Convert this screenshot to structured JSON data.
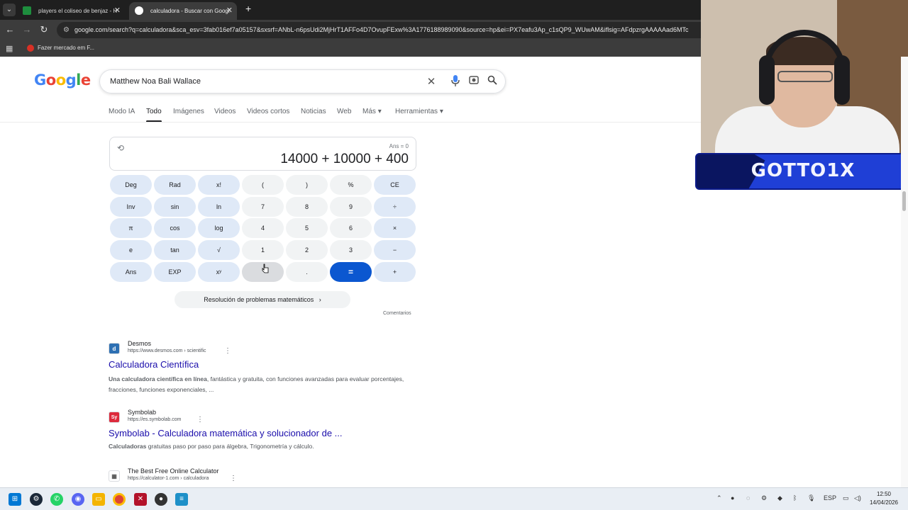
{
  "browser": {
    "tabs": [
      {
        "label": "players el coliseo de benjaz - H",
        "favicon_color": "#1e8e3e"
      },
      {
        "label": "calculadora - Buscar con Googl",
        "favicon_color": "#ffffff"
      }
    ],
    "url": "google.com/search?q=calculadora&sca_esv=3fab016ef7a05157&sxsrf=ANbL-n6psUdi2MjHrT1AFFo4D7OvupFExw%3A1776188989090&source=hp&ei=PX7eafu3Ap_c1sQP9_WUwAM&iflsig=AFdpzrgAAAAAad6MTc",
    "bookmark": "Fazer mercado em F..."
  },
  "google": {
    "logo": "Google",
    "query": "Matthew Noa Bali Wallace",
    "nav_tabs": [
      "Modo IA",
      "Todo",
      "Imágenes",
      "Videos",
      "Videos cortos",
      "Noticias",
      "Web",
      "Más",
      "Herramientas"
    ],
    "active_tab": "Todo"
  },
  "calculator": {
    "ans": "Ans = 0",
    "expression": "14000 + 10000 + 400",
    "keys": [
      [
        "Deg",
        "Rad",
        "x!",
        "(",
        ")",
        "%",
        "CE"
      ],
      [
        "Inv",
        "sin",
        "ln",
        "7",
        "8",
        "9",
        "÷"
      ],
      [
        "π",
        "cos",
        "log",
        "4",
        "5",
        "6",
        "×"
      ],
      [
        "e",
        "tan",
        "√",
        "1",
        "2",
        "3",
        "−"
      ],
      [
        "Ans",
        "EXP",
        "xʸ",
        "0",
        ".",
        "=",
        "+"
      ]
    ],
    "solver_label": "Resolución de problemas matemáticos",
    "feedback_label": "Comentarios"
  },
  "results": [
    {
      "site": "Desmos",
      "url": "https://www.desmos.com › scientific",
      "favicon_text": "d",
      "favicon_color": "#2d70b3",
      "title": "Calculadora Científica",
      "snippet_bold": "Una calculadora científica en línea",
      "snippet_rest": ", fantástica y gratuita, con funciones avanzadas para evaluar porcentajes, fracciones, funciones exponenciales, ..."
    },
    {
      "site": "Symbolab",
      "url": "https://es.symbolab.com",
      "favicon_text": "Sy",
      "favicon_color": "#dd2a3c",
      "title": "Symbolab - Calculadora matemática y solucionador de ...",
      "snippet_bold": "Calculadoras",
      "snippet_rest": " gratuitas paso por paso para álgebra, Trigonometría y cálculo."
    },
    {
      "site": "The Best Free Online Calculator",
      "url": "https://calculator-1.com › calculadora",
      "favicon_text": "▦",
      "favicon_color": "#555555"
    }
  ],
  "overlay": {
    "streamer_name": "GOTTO1X"
  },
  "taskbar": {
    "language": "ESP",
    "time": "12:50",
    "date": "14/04/2026"
  }
}
